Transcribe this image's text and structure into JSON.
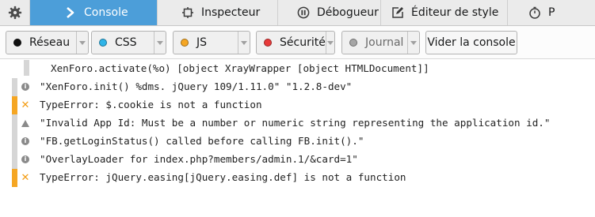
{
  "tabs": [
    {
      "label": "Console",
      "icon": "chevron-right-icon",
      "active": true
    },
    {
      "label": "Inspecteur",
      "icon": "inspector-icon",
      "active": false
    },
    {
      "label": "Débogueur",
      "icon": "pause-icon",
      "active": false
    },
    {
      "label": "Éditeur de style",
      "icon": "pencil-icon",
      "active": false
    },
    {
      "label": "P",
      "icon": "stopwatch-icon",
      "active": false
    }
  ],
  "filters": [
    {
      "label": "Réseau",
      "color": "#111111"
    },
    {
      "label": "CSS",
      "color": "#2fb4e8"
    },
    {
      "label": "JS",
      "color": "#f5a623"
    },
    {
      "label": "Sécurité",
      "color": "#e83a3a"
    },
    {
      "label": "Journal",
      "color": "#a6a6a6"
    }
  ],
  "clear_label": "Vider la console",
  "messages": [
    {
      "type": "continuation",
      "text": "XenForo.activate(%o) [object XrayWrapper [object HTMLDocument]]"
    },
    {
      "type": "info",
      "text": "\"XenForo.init() %dms. jQuery 109/1.11.0\" \"1.2.8-dev\""
    },
    {
      "type": "error",
      "text": "TypeError: $.cookie is not a function"
    },
    {
      "type": "warning",
      "text": "\"Invalid App Id: Must be a number or numeric string representing the application id.\""
    },
    {
      "type": "info",
      "text": "\"FB.getLoginStatus() called before calling FB.init().\""
    },
    {
      "type": "info",
      "text": "\"OverlayLoader for index.php?members/admin.1/&card=1\""
    },
    {
      "type": "error",
      "text": "TypeError: jQuery.easing[jQuery.easing.def] is not a function"
    }
  ]
}
